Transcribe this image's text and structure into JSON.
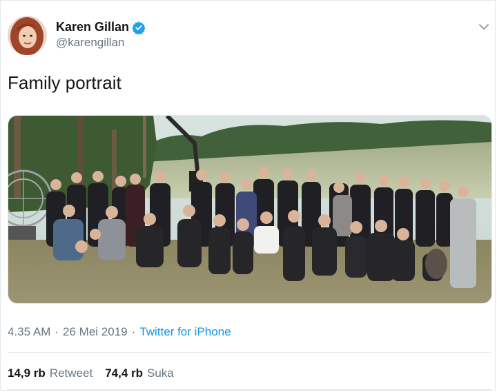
{
  "author": {
    "display_name": "Karen Gillan",
    "handle": "@karengillan",
    "verified_color": "#1da1f2"
  },
  "tweet": {
    "text": "Family portrait"
  },
  "meta": {
    "time": "4.35 AM",
    "separator": "·",
    "date": "26 Mei 2019",
    "source": "Twitter for iPhone"
  },
  "stats": {
    "retweets_count": "14,9 rb",
    "retweets_label": "Retweet",
    "likes_count": "74,4 rb",
    "likes_label": "Suka"
  },
  "icons": {
    "verified": "verified-badge-icon",
    "menu": "chevron-down-icon"
  },
  "colors": {
    "link": "#1b95e0",
    "secondary_text": "#657786",
    "primary_text": "#14171a"
  }
}
